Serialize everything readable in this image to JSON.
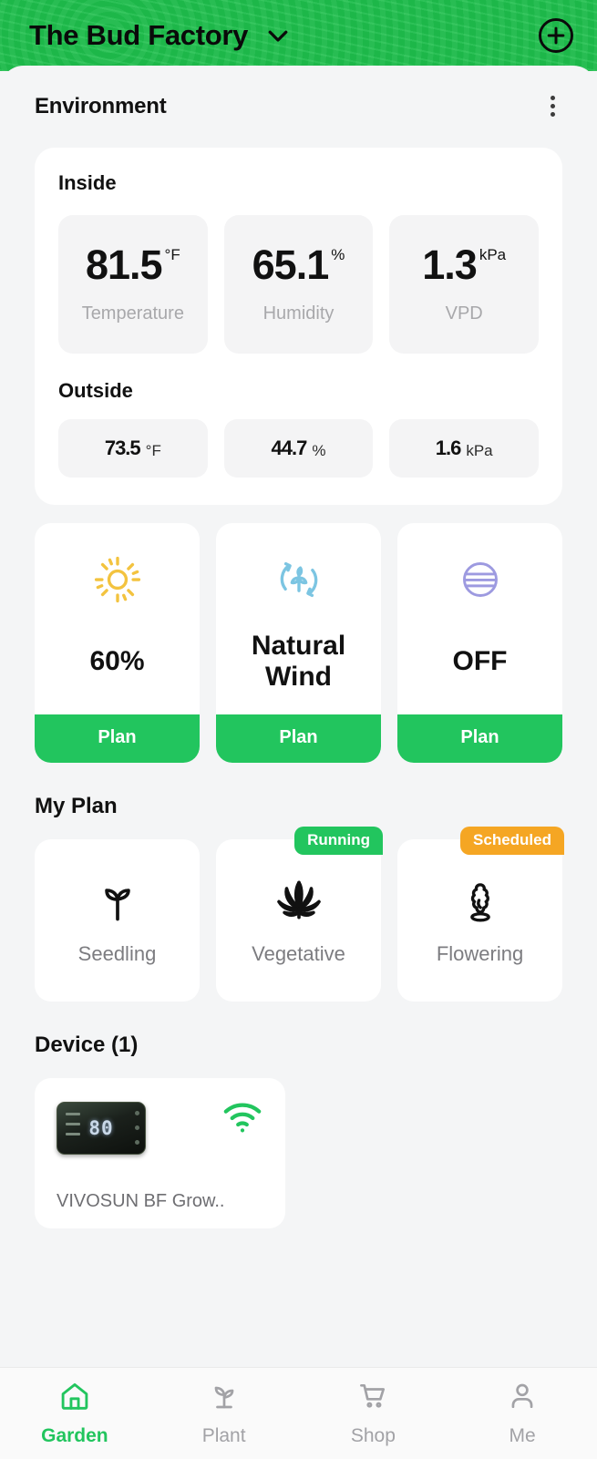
{
  "header": {
    "title": "The Bud Factory",
    "dropdown_icon": "chevron-down-icon",
    "add_icon": "plus-circle-icon",
    "background_color": "#1FC04D"
  },
  "environment": {
    "title": "Environment",
    "menu_icon": "kebab-menu-icon",
    "inside": {
      "label": "Inside",
      "metrics": [
        {
          "value": "81.5",
          "unit": "°F",
          "label": "Temperature"
        },
        {
          "value": "65.1",
          "unit": "%",
          "label": "Humidity"
        },
        {
          "value": "1.3",
          "unit": "kPa",
          "label": "VPD"
        }
      ]
    },
    "outside": {
      "label": "Outside",
      "metrics": [
        {
          "value": "73.5",
          "unit": "°F"
        },
        {
          "value": "44.7",
          "unit": "%"
        },
        {
          "value": "1.6",
          "unit": "kPa"
        }
      ]
    }
  },
  "controls": [
    {
      "icon": "sun-icon",
      "icon_color": "#F3C33F",
      "value": "60%",
      "plan_label": "Plan"
    },
    {
      "icon": "natural-wind-icon",
      "icon_color": "#7CC5E2",
      "value": "Natural Wind",
      "plan_label": "Plan"
    },
    {
      "icon": "humidity-circle-icon",
      "icon_color": "#9D9AE0",
      "value": "OFF",
      "plan_label": "Plan"
    }
  ],
  "my_plan": {
    "title": "My Plan",
    "stages": [
      {
        "icon": "seedling-icon",
        "label": "Seedling",
        "badge": null,
        "badge_color": null
      },
      {
        "icon": "cannabis-leaf-icon",
        "label": "Vegetative",
        "badge": "Running",
        "badge_color": "#22C55E"
      },
      {
        "icon": "flower-bud-icon",
        "label": "Flowering",
        "badge": "Scheduled",
        "badge_color": "#F5A623"
      }
    ]
  },
  "device_section": {
    "title": "Device (1)",
    "devices": [
      {
        "name": "VIVOSUN BF Grow..",
        "display_value": "80",
        "wifi_icon": "wifi-icon",
        "wifi_color": "#22C55E"
      }
    ]
  },
  "bottom_nav": {
    "items": [
      {
        "icon": "home-icon",
        "label": "Garden",
        "active": true
      },
      {
        "icon": "plant-icon",
        "label": "Plant",
        "active": false
      },
      {
        "icon": "cart-icon",
        "label": "Shop",
        "active": false
      },
      {
        "icon": "person-icon",
        "label": "Me",
        "active": false
      }
    ],
    "active_color": "#22C55E",
    "inactive_color": "#A2A2A6"
  }
}
